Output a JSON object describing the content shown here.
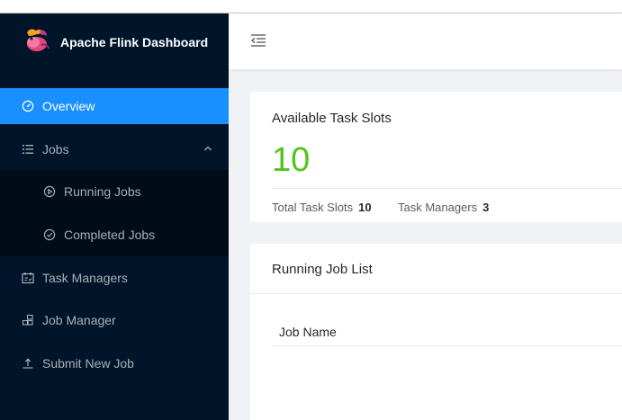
{
  "app": {
    "title": "Apache Flink Dashboard",
    "logo_icon": "squirrel-logo-icon",
    "accent": "#1890ff",
    "sidebar_bg": "#001529",
    "submenu_bg": "#000c17",
    "success_color": "#52c41a"
  },
  "sidebar": {
    "items": [
      {
        "label": "Overview",
        "icon": "dashboard-icon",
        "active": true
      },
      {
        "label": "Jobs",
        "icon": "list-icon",
        "expanded": true
      },
      {
        "label": "Task Managers",
        "icon": "schedule-icon"
      },
      {
        "label": "Job Manager",
        "icon": "cluster-icon"
      },
      {
        "label": "Submit New Job",
        "icon": "upload-icon"
      }
    ],
    "jobs_children": [
      {
        "label": "Running Jobs",
        "icon": "play-circle-icon"
      },
      {
        "label": "Completed Jobs",
        "icon": "check-circle-icon"
      }
    ]
  },
  "header": {
    "menu_fold_icon": "menu-fold-icon"
  },
  "slots_card": {
    "title": "Available Task Slots",
    "value": "10",
    "total_label": "Total Task Slots",
    "total_value": "10",
    "tm_label": "Task Managers",
    "tm_value": "3"
  },
  "running_card": {
    "title": "Running Job List",
    "columns": [
      "Job Name"
    ]
  }
}
